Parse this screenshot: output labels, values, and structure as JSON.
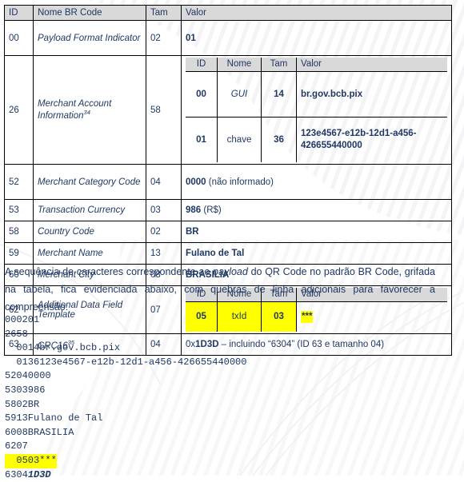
{
  "table": {
    "headers": {
      "id": "ID",
      "nome": "Nome BR Code",
      "tam": "Tam",
      "valor": "Valor"
    },
    "nested_headers": {
      "id": "ID",
      "nome": "Nome",
      "tam": "Tam",
      "valor": "Valor"
    },
    "rows": [
      {
        "id": "00",
        "nome": "Payload Format Indicator",
        "tam": "02",
        "valor_bold": "01",
        "valor_rest": ""
      },
      {
        "id": "26",
        "nome": "Merchant Account Information",
        "nome_sup": "34",
        "tam": "58",
        "nested": [
          {
            "id": "00",
            "nome": "GUI",
            "nome_italic": true,
            "tam": "14",
            "valor": "br.gov.bcb.pix"
          },
          {
            "id": "01",
            "nome": "chave",
            "nome_italic": false,
            "tam": "36",
            "valor": "123e4567-e12b-12d1-a456-426655440000"
          }
        ]
      },
      {
        "id": "52",
        "nome": "Merchant Category Code",
        "tam": "04",
        "valor_bold": "0000",
        "valor_rest": " (não informado)"
      },
      {
        "id": "53",
        "nome": "Transaction Currency",
        "tam": "03",
        "valor_bold": "986",
        "valor_rest": " (R$)"
      },
      {
        "id": "58",
        "nome": "Country Code",
        "tam": "02",
        "valor_bold": "BR",
        "valor_rest": ""
      },
      {
        "id": "59",
        "nome": "Merchant Name",
        "tam": "13",
        "valor_bold": "Fulano de Tal",
        "valor_rest": ""
      },
      {
        "id": "60",
        "nome": "Merchant City",
        "tam": "08",
        "valor_bold": "BRASILIA",
        "valor_rest": ""
      },
      {
        "id": "62",
        "nome": "Additional Data Field Template",
        "tam": "07",
        "nested_highlighted": [
          {
            "id": "05",
            "nome": "txId",
            "tam": "03",
            "valor": "***"
          }
        ]
      },
      {
        "id": "63",
        "nome": "CRC16",
        "nome_sup": "35",
        "tam": "04",
        "valor_prefix": "0x",
        "valor_bold": "1D3D",
        "valor_rest": " – incluindo “6304” (ID 63 e tamanho 04)"
      }
    ]
  },
  "paragraph": {
    "part1": "A sequência de caracteres correspondente ao ",
    "emphasis": "payload",
    "part2": " do QR Code no padrão BR Code, grifada na tabela, fica evidenciada abaixo, com quebras de linha adicionais para favorecer a compreensão:"
  },
  "payload": {
    "lines": [
      {
        "text": "000201",
        "highlight": false,
        "bolditalic": ""
      },
      {
        "text": "2658",
        "highlight": false,
        "bolditalic": ""
      },
      {
        "text": "  0014br.gov.bcb.pix",
        "highlight": false,
        "bolditalic": ""
      },
      {
        "text": "  0136123e4567-e12b-12d1-a456-426655440000",
        "highlight": false,
        "bolditalic": ""
      },
      {
        "text": "52040000",
        "highlight": false,
        "bolditalic": ""
      },
      {
        "text": "5303986",
        "highlight": false,
        "bolditalic": ""
      },
      {
        "text": "5802BR",
        "highlight": false,
        "bolditalic": ""
      },
      {
        "text": "5913Fulano de Tal",
        "highlight": false,
        "bolditalic": ""
      },
      {
        "text": "6008BRASILIA",
        "highlight": false,
        "bolditalic": ""
      },
      {
        "text": "6207",
        "highlight": false,
        "bolditalic": ""
      },
      {
        "text": "  0503***",
        "highlight": true,
        "bolditalic": ""
      },
      {
        "text": "6304",
        "highlight": false,
        "bolditalic": "1D3D"
      }
    ]
  },
  "colors": {
    "text": "#1f3864",
    "header_bg": "#d9d9d9",
    "highlight": "#ffff00",
    "border": "#000000",
    "page_bg": "#ffffff"
  }
}
